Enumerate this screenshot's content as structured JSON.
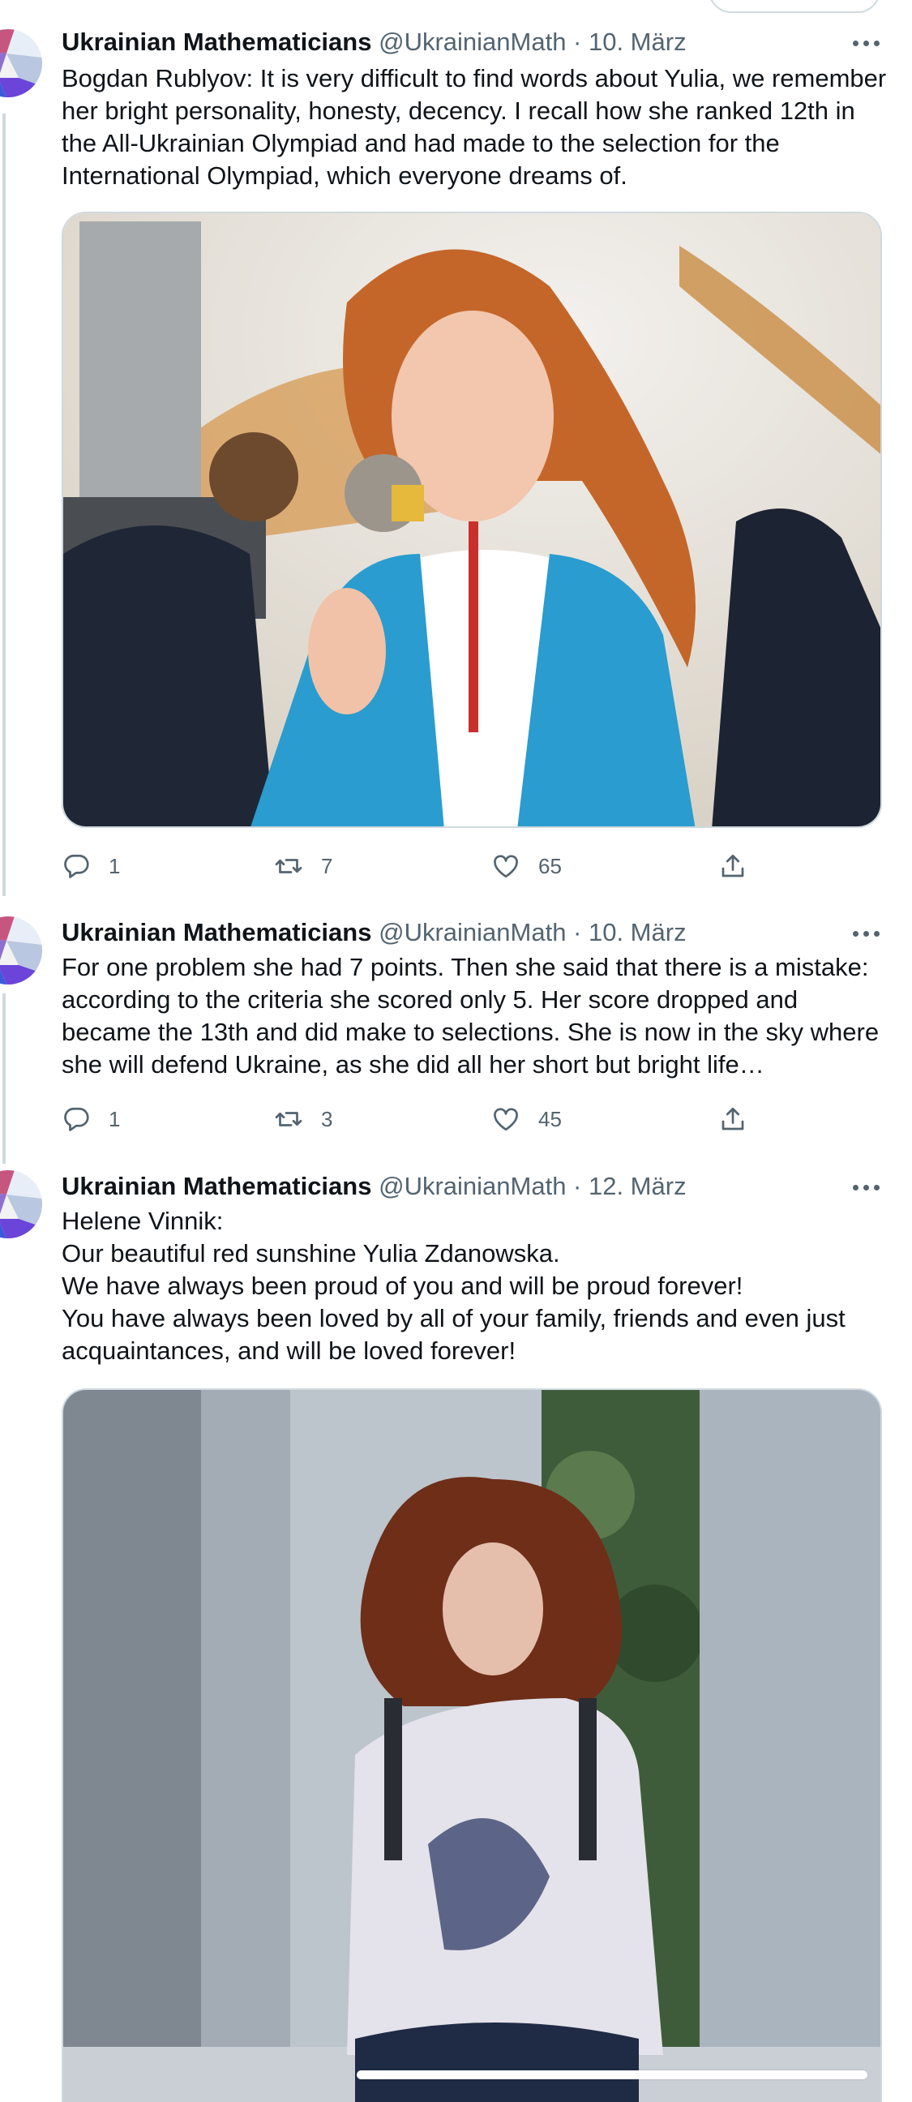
{
  "tweets": [
    {
      "name": "Ukrainian Mathematicians",
      "meta": "@UkrainianMath · 10. März",
      "text": "Bogdan Rublyov: It is very difficult to find words about Yulia,  we remember her bright personality, honesty, decency. I recall how she ranked 12th in the All-Ukrainian Olympiad and had made to the selection for the International Olympiad, which everyone dreams of.",
      "replies": "1",
      "retweets": "7",
      "likes": "65"
    },
    {
      "name": "Ukrainian Mathematicians",
      "meta": "@UkrainianMath · 10. März",
      "text": "For one problem she had 7 points. Then she said that there is a mistake: according to the criteria she scored only 5. Her score dropped and became the 13th and did make to selections. She is now in the sky where she will defend Ukraine, as she did all her short but bright life…",
      "replies": "1",
      "retweets": "3",
      "likes": "45"
    },
    {
      "name": "Ukrainian Mathematicians",
      "meta": "@UkrainianMath · 12. März",
      "text": "Helene Vinnik:\nOur beautiful red sunshine Yulia Zdanowska.\nWe have always been proud of you and will be proud forever!\nYou have always been loved by all of your family, friends and even just acquaintances, and will be loved forever!"
    }
  ],
  "colors": {
    "text": "#0f1419",
    "secondary": "#536471",
    "border": "#cfd9de"
  },
  "icons": [
    "reply-icon",
    "retweet-icon",
    "like-icon",
    "share-icon",
    "more-icon"
  ]
}
